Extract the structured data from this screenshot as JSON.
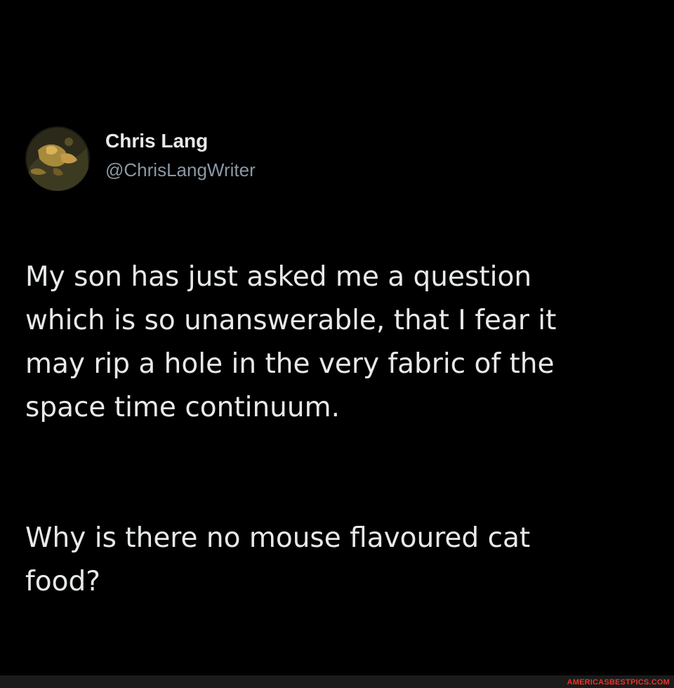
{
  "tweet": {
    "author": {
      "display_name": "Chris Lang",
      "handle": "@ChrisLangWriter",
      "avatar_icon": "profile-photo-avatar"
    },
    "paragraphs": [
      "My son has just asked me a question\nwhich is so unanswerable, that I fear it\nmay rip a hole in the very fabric of the\nspace time continuum.",
      "Why is there no mouse flavoured cat\nfood?"
    ]
  },
  "watermark": {
    "text": "AMERICASBESTPICS.COM",
    "color": "#e8362b"
  },
  "colors": {
    "background": "#000000",
    "text_primary": "#e7e9ea",
    "text_secondary": "#8b98a5"
  }
}
